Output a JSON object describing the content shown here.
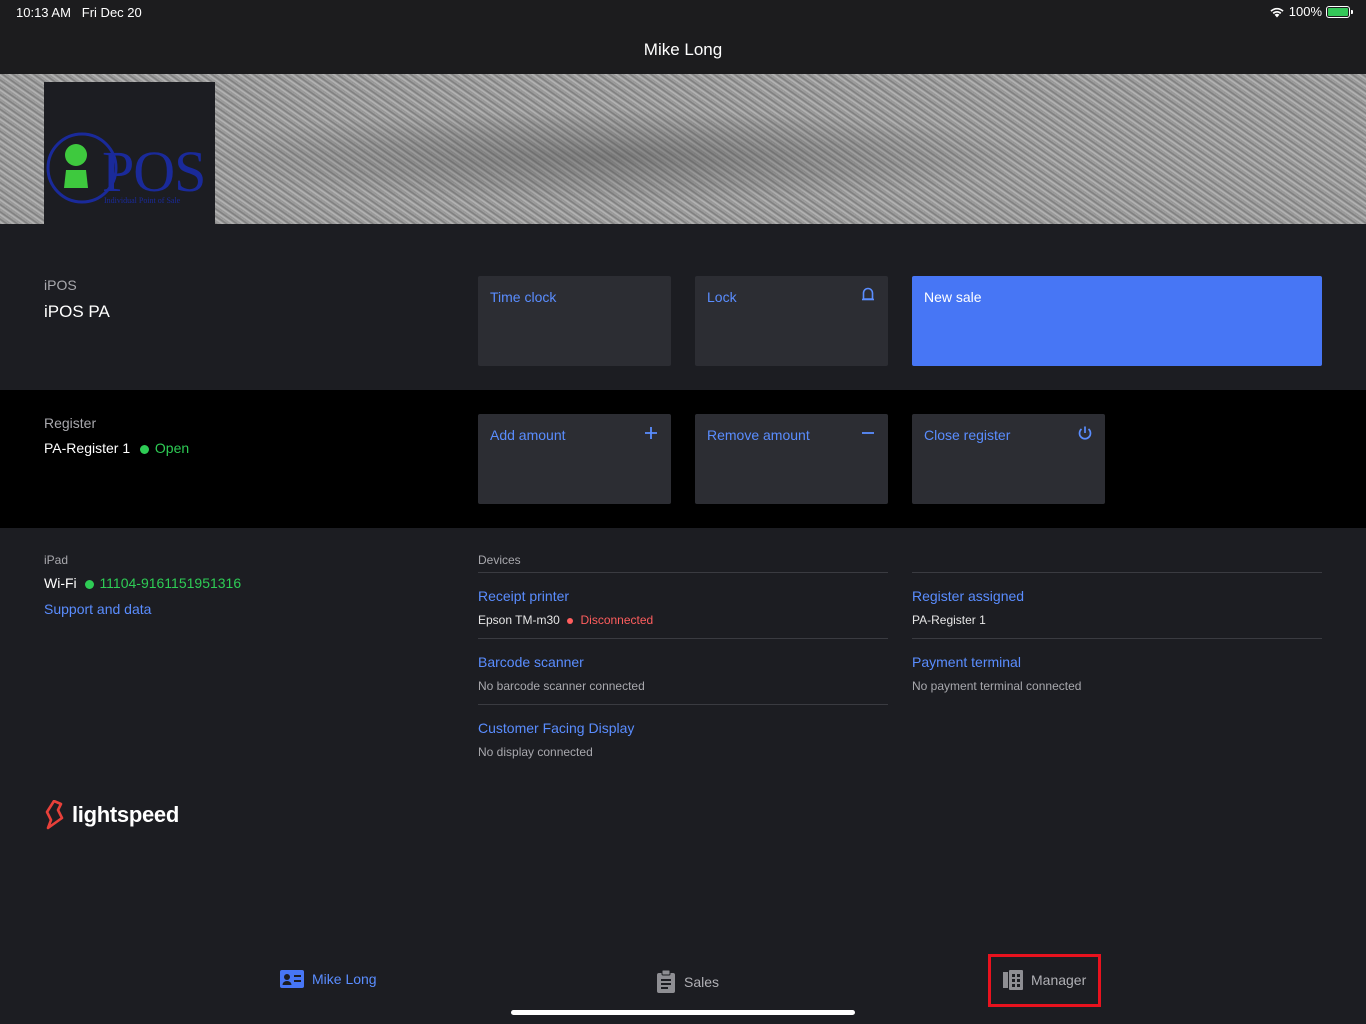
{
  "status": {
    "time": "10:13 AM",
    "date": "Fri Dec 20",
    "battery": "100%"
  },
  "navbar": {
    "title": "Mike Long"
  },
  "store": {
    "label": "iPOS",
    "name": "iPOS PA",
    "logo_text": "POS",
    "logo_subtitle": "Individual Point of Sale"
  },
  "actions": {
    "time_clock": "Time clock",
    "lock": "Lock",
    "new_sale": "New sale"
  },
  "register": {
    "label": "Register",
    "name": "PA-Register 1",
    "status": "Open",
    "add_amount": "Add amount",
    "remove_amount": "Remove amount",
    "close_register": "Close register"
  },
  "ipad": {
    "label": "iPad",
    "wifi_label": "Wi-Fi",
    "wifi_value": "11104-9161151951316",
    "support_link": "Support and data"
  },
  "devices": {
    "header": "Devices",
    "receipt_printer": {
      "title": "Receipt printer",
      "model": "Epson TM-m30",
      "status": "Disconnected"
    },
    "barcode_scanner": {
      "title": "Barcode scanner",
      "status": "No barcode scanner connected"
    },
    "customer_display": {
      "title": "Customer Facing Display",
      "status": "No display connected"
    },
    "register_assigned": {
      "title": "Register assigned",
      "value": "PA-Register 1"
    },
    "payment_terminal": {
      "title": "Payment terminal",
      "status": "No payment terminal connected"
    }
  },
  "brand": {
    "name": "lightspeed"
  },
  "tabs": [
    {
      "label": "Mike Long",
      "icon": "contact-card-icon",
      "active": true
    },
    {
      "label": "Sales",
      "icon": "clipboard-icon",
      "active": false
    },
    {
      "label": "Manager",
      "icon": "building-icon",
      "active": false
    }
  ],
  "colors": {
    "accent": "#4776f5",
    "link": "#5a8dff",
    "open": "#2ecc55",
    "disconnected": "#ff5e5e",
    "highlight": "#e8121e"
  }
}
